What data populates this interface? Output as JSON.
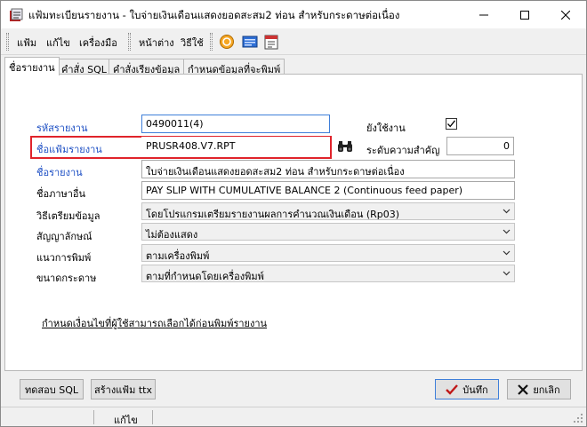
{
  "window": {
    "title": "แฟ้มทะเบียนรายงาน - ใบจ่ายเงินเดือนแสดงยอดสะสม2 ท่อน สำหรับกระดาษต่อเนื่อง"
  },
  "menu": {
    "file": "แฟ้ม",
    "edit": "แก้ไข",
    "tools": "เครื่องมือ",
    "window": "หน้าต่าง",
    "help": "วิธีใช้"
  },
  "tabs": [
    {
      "label": "ชื่อรายงาน",
      "active": true
    },
    {
      "label": "คำสั่ง SQL",
      "active": false
    },
    {
      "label": "คำสั่งเรียงข้อมูล",
      "active": false
    },
    {
      "label": "กำหนดข้อมูลที่จะพิมพ์",
      "active": false
    }
  ],
  "form": {
    "report_code": {
      "label": "รหัสรายงาน",
      "value": "0490011(4)"
    },
    "report_file": {
      "label": "ชื่อแฟ้มรายงาน",
      "value": "PRUSR408.V7.RPT"
    },
    "report_name": {
      "label": "ชื่อรายงาน",
      "value": "ใบจ่ายเงินเดือนแสดงยอดสะสม2 ท่อน สำหรับกระดาษต่อเนื่อง"
    },
    "other_lang_name": {
      "label": "ชื่อภาษาอื่น",
      "value": "PAY SLIP WITH CUMULATIVE BALANCE 2 (Continuous feed paper)"
    },
    "data_prep": {
      "label": "วิธีเตรียมข้อมูล",
      "value": "โดยโปรแกรมเตรียมรายงานผลการคำนวณเงินเดือน (Rp03)"
    },
    "symbol": {
      "label": "สัญญาลักษณ์",
      "value": "ไม่ต้องแสดง"
    },
    "orientation": {
      "label": "แนวการพิมพ์",
      "value": "ตามเครื่องพิมพ์"
    },
    "paper_size": {
      "label": "ขนาดกระดาษ",
      "value": "ตามที่กำหนดโดยเครื่องพิมพ์"
    },
    "in_use": {
      "label": "ยังใช้งาน",
      "checked": true
    },
    "priority": {
      "label": "ระดับความสำคัญ",
      "value": "0"
    }
  },
  "condition_link": "กำหนดเงื่อนไขที่ผู้ใช้สามารถเลือกได้ก่อนพิมพ์รายงาน",
  "buttons": {
    "test_sql": "ทดสอบ SQL",
    "create_ttx": "สร้างแฟ้ม ttx",
    "save": "บันทึก",
    "cancel": "ยกเลิก"
  },
  "status": {
    "mode": "แก้ไข"
  },
  "icons": {
    "app": "report-register-icon",
    "search": "binoculars-icon",
    "tb1": "refresh-icon",
    "tb2": "keyboard-icon",
    "tb3": "calendar-icon"
  }
}
